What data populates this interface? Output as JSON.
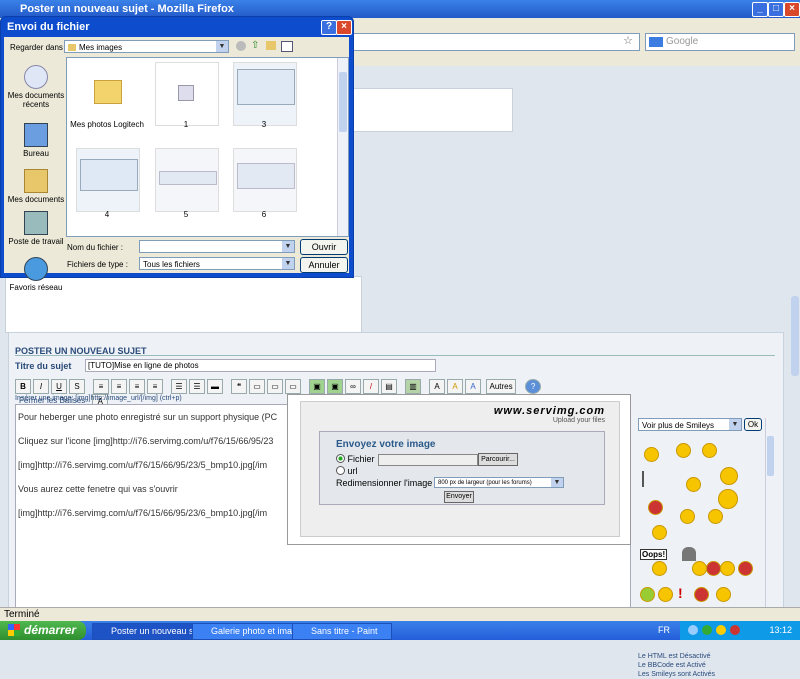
{
  "browser": {
    "title": "Poster un nouveau sujet - Mozilla Firefox",
    "search_placeholder": "Google",
    "status": "Terminé"
  },
  "taskbar": {
    "start_label": "démarrer",
    "tasks": [
      "Poster un nouveau s...",
      "Galerie photo et imag...",
      "Sans titre - Paint"
    ],
    "lang": "FR",
    "clock": "13:12"
  },
  "dialog": {
    "title": "Envoi du fichier",
    "look_in_label": "Regarder dans :",
    "look_in_value": "Mes images",
    "places": [
      "Mes documents récents",
      "Bureau",
      "Mes documents",
      "Poste de travail",
      "Favoris réseau"
    ],
    "files": [
      "Mes photos Logitech",
      "1",
      "3",
      "4",
      "5",
      "6"
    ],
    "filename_label": "Nom du fichier :",
    "filename_value": "",
    "filetype_label": "Fichiers de type :",
    "filetype_value": "Tous les fichiers",
    "open_label": "Ouvrir",
    "cancel_label": "Annuler"
  },
  "post": {
    "section_title": "POSTER UN NOUVEAU SUJET",
    "subject_label": "Titre du sujet",
    "subject_value": "[TUTO]Mise en ligne de photos",
    "toolbar": {
      "autres": "Autres",
      "fermer": "Fermer les Balises"
    },
    "insert_hint": "Insérer une image: [img]http://image_url/[/img] (ctrl+p)",
    "lines": [
      "Pour heberger une photo enregistré sur un support physique (PC",
      "Cliquez sur l'icone [img]http://i76.servimg.com/u/f76/15/66/95/23",
      "[img]http://i76.servimg.com/u/f76/15/66/95/23/5_bmp10.jpg[/im",
      "Vous aurez cette fenetre qui vas s'ouvrir",
      "[img]http://i76.servimg.com/u/f76/15/66/95/23/6_bmp10.jpg[/im"
    ]
  },
  "servimg": {
    "logo": "www.servimg.com",
    "tagline": "Upload your files",
    "heading": "Envoyez votre image",
    "opt_file": "Fichier",
    "browse": "Parcourir...",
    "opt_url": "url",
    "resize_label": "Redimensionner l'image",
    "resize_value": "800 px de largeur (pour les forums)",
    "send": "Envoyer"
  },
  "smileys": {
    "select_value": "Voir plus de Smileys",
    "ok": "Ok",
    "oops_text": "Oops!",
    "info": [
      "Le HTML est Désactivé",
      "Le BBCode est Activé",
      "Les Smileys sont Activés"
    ]
  }
}
